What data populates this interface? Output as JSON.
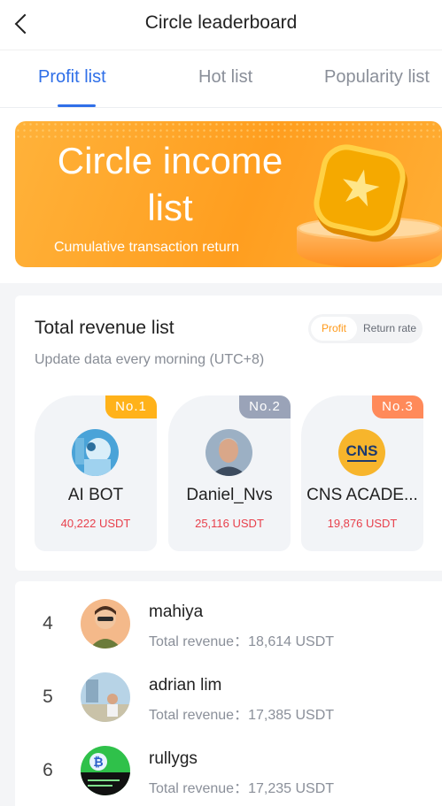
{
  "header": {
    "title": "Circle leaderboard",
    "back_icon": "chevron-left-icon"
  },
  "tabs": [
    {
      "label": "Profit list",
      "active": true
    },
    {
      "label": "Hot list",
      "active": false
    },
    {
      "label": "Popularity list",
      "active": false
    }
  ],
  "banner": {
    "title": "Circle income list",
    "subtitle": "Cumulative transaction return",
    "illustration": "coin-on-podium-icon"
  },
  "revenue": {
    "title": "Total revenue list",
    "subtitle": "Update data every morning (UTC+8)",
    "toggle": {
      "options": [
        "Profit",
        "Return rate"
      ],
      "selected": "Profit"
    },
    "top3": [
      {
        "rank_label": "No.1",
        "name": "AI BOT",
        "value": "40,222 USDT",
        "badge_color": "#ffb21a",
        "avatar": "robot-avatar"
      },
      {
        "rank_label": "No.2",
        "name": "Daniel_Nvs",
        "value": "25,116 USDT",
        "badge_color": "#9aa3b8",
        "avatar": "man-portrait-avatar"
      },
      {
        "rank_label": "No.3",
        "name": "CNS ACADE...",
        "value": "19,876 USDT",
        "badge_color": "#ff8a5a",
        "avatar": "cns-logo-avatar"
      }
    ]
  },
  "list": [
    {
      "rank": "4",
      "name": "mahiya",
      "revenue_label": "Total revenue：",
      "revenue": "18,614 USDT",
      "avatar": "cartoon-avatar"
    },
    {
      "rank": "5",
      "name": "adrian lim",
      "revenue_label": "Total revenue：",
      "revenue": "17,385 USDT",
      "avatar": "photo-avatar"
    },
    {
      "rank": "6",
      "name": "rullygs",
      "revenue_label": "Total revenue：",
      "revenue": "17,235 USDT",
      "avatar": "bitcoin-avatar"
    }
  ],
  "colors": {
    "accent": "#2f6fe8",
    "banner": "#ffa52a",
    "revenue_red": "#e8404c",
    "toggle_active": "#ff9a1a"
  }
}
